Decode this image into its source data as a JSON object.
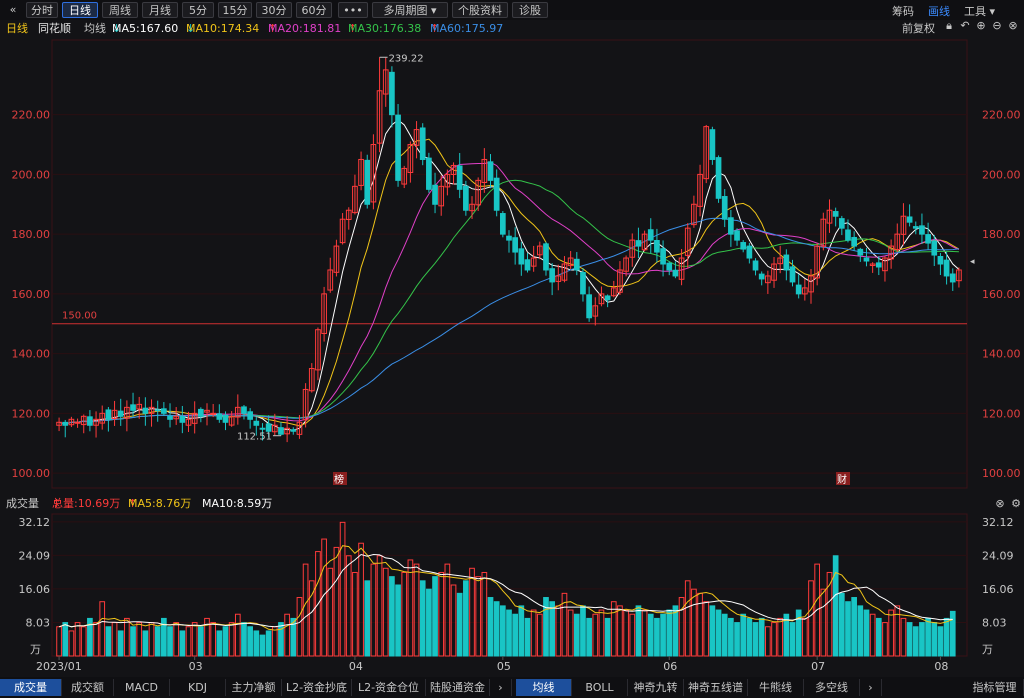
{
  "toolbar": {
    "back_icon": "double-chevron-left-icon",
    "tabs": [
      "分时",
      "日线",
      "周线",
      "月线",
      "5分",
      "15分",
      "30分",
      "60分"
    ],
    "active_tab": "日线",
    "more_icon": "more-dots-icon",
    "multi_period": "多周期图",
    "stock_info": "个股资料",
    "diagnose": "诊股",
    "chips": "筹码",
    "draw": "画线",
    "tools": "工具"
  },
  "info": {
    "period": "日线",
    "name": "同花顺",
    "avg_label": "均线",
    "ma5": "MA5:167.60",
    "ma10": "MA10:174.34",
    "ma20": "MA20:181.81",
    "ma30": "MA30:176.38",
    "ma60": "MA60:175.97",
    "adjust": "前复权",
    "colors": {
      "ma5": "#ffffff",
      "ma10": "#f0c419",
      "ma20": "#e040c8",
      "ma30": "#34c34a",
      "ma60": "#3a8ee6"
    }
  },
  "price_panel": {
    "ref_line": "150.00",
    "high_label": "239.22",
    "low_label": "112.51",
    "event_markers": [
      "榜",
      "财"
    ]
  },
  "volume_info": {
    "title": "成交量",
    "total": "总量:10.69万",
    "ma5": "MA5:8.76万",
    "ma10": "MA10:8.59万"
  },
  "volume_panel": {
    "unit": "万"
  },
  "bottom_tabs": {
    "left": [
      "成交量",
      "成交额",
      "MACD",
      "KDJ",
      "主力净额",
      "L2-资金抄底",
      "L2-资金仓位",
      "陆股通资金"
    ],
    "right": [
      "均线",
      "BOLL",
      "神奇九转",
      "神奇五线谱",
      "牛熊线",
      "多空线"
    ],
    "settings": "指标管理"
  },
  "colors": {
    "up": "#ff3b3b",
    "down": "#19c5c5",
    "grid": "#2a0f12",
    "axis_text_price": "#e04040",
    "axis_text_volume": "#c8c8c8"
  },
  "chart_data": [
    {
      "type": "candlestick",
      "title": "同花顺 日线",
      "ylim": [
        95,
        245
      ],
      "y_ticks": [
        100.0,
        120.0,
        140.0,
        160.0,
        180.0,
        200.0,
        220.0
      ],
      "x_labels": [
        "03",
        "04",
        "05",
        "06",
        "07",
        "08"
      ],
      "reference_line": 150.0,
      "annotations": [
        {
          "label": "239.22",
          "value": 239.22
        },
        {
          "label": "112.51",
          "value": 112.51
        }
      ],
      "closes": [
        117,
        116,
        118,
        117,
        119,
        116,
        118,
        120,
        118,
        121,
        119,
        122,
        121,
        123,
        120,
        122,
        121,
        120,
        118,
        119,
        117,
        118,
        120,
        119,
        121,
        120,
        118,
        117,
        119,
        122,
        120,
        118,
        116,
        115,
        114,
        116,
        113,
        115,
        114,
        117,
        128,
        135,
        148,
        160,
        168,
        176,
        185,
        188,
        196,
        205,
        190,
        210,
        228,
        235,
        220,
        198,
        202,
        210,
        215,
        205,
        195,
        190,
        196,
        200,
        203,
        195,
        188,
        190,
        198,
        205,
        198,
        188,
        180,
        178,
        174,
        170,
        168,
        172,
        176,
        168,
        164,
        166,
        170,
        172,
        168,
        160,
        152,
        156,
        160,
        158,
        162,
        168,
        172,
        178,
        176,
        180,
        178,
        174,
        170,
        168,
        166,
        172,
        182,
        190,
        200,
        216,
        205,
        192,
        185,
        180,
        178,
        175,
        172,
        168,
        165,
        166,
        170,
        172,
        168,
        164,
        160,
        162,
        166,
        176,
        185,
        188,
        186,
        182,
        178,
        176,
        173,
        171,
        170,
        169,
        172,
        176,
        180,
        186,
        184,
        182,
        180,
        177,
        173,
        170,
        166,
        164,
        168
      ],
      "volumes": [
        7,
        8,
        6,
        8,
        7,
        9,
        8,
        13,
        7,
        8,
        6,
        9,
        7,
        8,
        6,
        8,
        7,
        9,
        7,
        8,
        6,
        7,
        8,
        7,
        9,
        8,
        6,
        7,
        8,
        10,
        8,
        7,
        6,
        5,
        6,
        7,
        8,
        10,
        9,
        14,
        22,
        18,
        25,
        28,
        21,
        26,
        32,
        24,
        20,
        27,
        18,
        22,
        24,
        21,
        19,
        17,
        20,
        23,
        22,
        18,
        16,
        19,
        20,
        22,
        17,
        15,
        18,
        21,
        19,
        20,
        14,
        13,
        12,
        11,
        10,
        12,
        9,
        11,
        10,
        14,
        13,
        12,
        15,
        11,
        10,
        12,
        9,
        10,
        11,
        9,
        13,
        12,
        11,
        10,
        12,
        11,
        10,
        9,
        10,
        11,
        12,
        14,
        18,
        16,
        15,
        13,
        12,
        11,
        10,
        9,
        8,
        10,
        9,
        8,
        9,
        7,
        8,
        9,
        10,
        8,
        11,
        9,
        18,
        22,
        16,
        20,
        24,
        15,
        13,
        14,
        12,
        11,
        10,
        9,
        8,
        11,
        12,
        9,
        8,
        7,
        8,
        9,
        8,
        7,
        9,
        10.69
      ],
      "ma_series": [
        {
          "name": "MA5",
          "last": 167.6
        },
        {
          "name": "MA10",
          "last": 174.34
        },
        {
          "name": "MA20",
          "last": 181.81
        },
        {
          "name": "MA30",
          "last": 176.38
        },
        {
          "name": "MA60",
          "last": 175.97
        }
      ]
    },
    {
      "type": "bar",
      "title": "成交量",
      "unit": "万",
      "y_ticks": [
        8.03,
        16.06,
        24.09,
        32.12
      ],
      "x_labels": [
        "2023/01",
        "03",
        "04",
        "05",
        "06",
        "07",
        "08"
      ]
    }
  ]
}
